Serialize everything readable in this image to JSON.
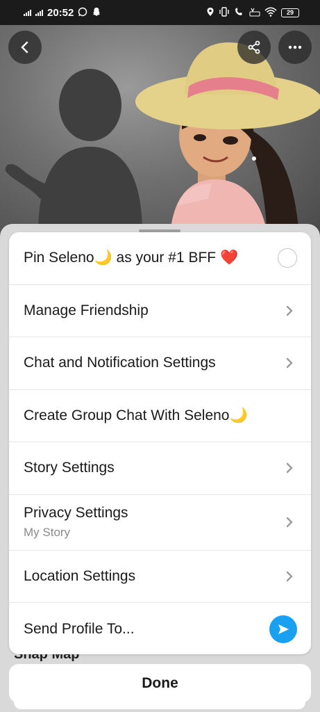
{
  "status_bar": {
    "time": "20:52",
    "battery": "29"
  },
  "menu": {
    "items": [
      {
        "label": "Pin Seleno🌙 as your #1 BFF ❤️",
        "control": "radio"
      },
      {
        "label": "Manage Friendship",
        "control": "chevron"
      },
      {
        "label": "Chat and Notification Settings",
        "control": "chevron"
      },
      {
        "label": "Create Group Chat With Seleno🌙",
        "control": "none"
      },
      {
        "label": "Story Settings",
        "control": "chevron"
      },
      {
        "label": "Privacy Settings",
        "sublabel": "My Story",
        "control": "chevron"
      },
      {
        "label": "Location Settings",
        "control": "chevron"
      },
      {
        "label": "Send Profile To...",
        "control": "send-icon"
      }
    ]
  },
  "background_section": {
    "label": "Snap Map"
  },
  "done_label": "Done",
  "colors": {
    "accent_blue": "#1aa0f0",
    "sheet_bg": "#d9d9d9",
    "card_bg": "#ffffff"
  }
}
